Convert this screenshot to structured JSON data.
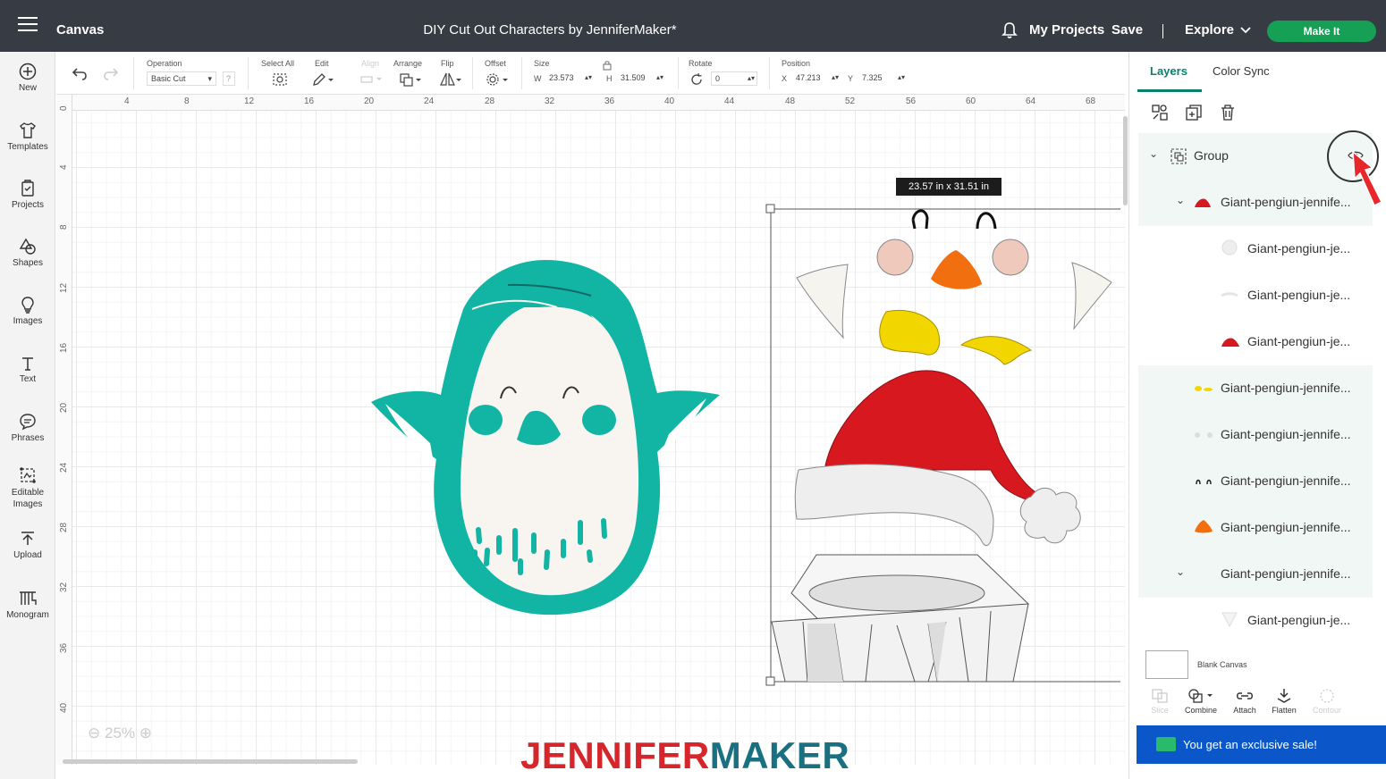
{
  "header": {
    "canvas_label": "Canvas",
    "doc_title": "DIY Cut Out Characters by JenniferMaker*",
    "my_projects": "My Projects",
    "save": "Save",
    "divider": "|",
    "explore": "Explore",
    "make_it": "Make It"
  },
  "leftnav": [
    {
      "label": "New",
      "icon": "plus-circle-icon"
    },
    {
      "label": "Templates",
      "icon": "shirt-icon"
    },
    {
      "label": "Projects",
      "icon": "projects-icon"
    },
    {
      "label": "Shapes",
      "icon": "shapes-icon"
    },
    {
      "label": "Images",
      "icon": "lightbulb-icon"
    },
    {
      "label": "Text",
      "icon": "text-icon"
    },
    {
      "label": "Phrases",
      "icon": "speech-bubble-icon"
    },
    {
      "label": "Editable Images",
      "icon": "editable-images-icon"
    },
    {
      "label": "Upload",
      "icon": "upload-icon"
    },
    {
      "label": "Monogram",
      "icon": "monogram-icon"
    }
  ],
  "toolbar": {
    "operation_label": "Operation",
    "operation_value": "Basic Cut",
    "help": "?",
    "select_all_label": "Select All",
    "edit_label": "Edit",
    "align_label": "Align",
    "arrange_label": "Arrange",
    "flip_label": "Flip",
    "offset_label": "Offset",
    "size_label": "Size",
    "w_label": "W",
    "w_value": "23.573",
    "h_label": "H",
    "h_value": "31.509",
    "rotate_label": "Rotate",
    "rotate_value": "0",
    "position_label": "Position",
    "x_label": "X",
    "x_value": "47.213",
    "y_label": "Y",
    "y_value": "7.325"
  },
  "ruler": {
    "top": [
      "4",
      "8",
      "12",
      "16",
      "20",
      "24",
      "28",
      "32",
      "36",
      "40",
      "44",
      "48",
      "52",
      "56",
      "60",
      "64",
      "68"
    ],
    "left": [
      "0",
      "4",
      "8",
      "12",
      "16",
      "20",
      "24",
      "28",
      "32",
      "36",
      "40"
    ]
  },
  "size_tooltip": "23.57  in x 31.51  in",
  "zoom": "25%",
  "panel": {
    "tab_layers": "Layers",
    "tab_color_sync": "Color Sync",
    "group_label": "Group",
    "layers": [
      {
        "name": "Giant-pengiun-jennife...",
        "color": "#d7191f",
        "indent": 1,
        "expanded": true
      },
      {
        "name": "Giant-pengiun-je...",
        "color": "#eeeeee",
        "indent": 2
      },
      {
        "name": "Giant-pengiun-je...",
        "color": "#f4f4f4",
        "indent": 2
      },
      {
        "name": "Giant-pengiun-je...",
        "color": "#d7191f",
        "indent": 2
      },
      {
        "name": "Giant-pengiun-jennife...",
        "color": "#f2d600",
        "indent": 1
      },
      {
        "name": "Giant-pengiun-jennife...",
        "color": "#dddddd",
        "indent": 1
      },
      {
        "name": "Giant-pengiun-jennife...",
        "color": "#222222",
        "indent": 1
      },
      {
        "name": "Giant-pengiun-jennife...",
        "color": "#f26f10",
        "indent": 1
      },
      {
        "name": "Giant-pengiun-jennife...",
        "color": "#ffffff",
        "indent": 1,
        "expanded": true
      },
      {
        "name": "Giant-pengiun-je...",
        "color": "#eeeeee",
        "indent": 2
      }
    ],
    "blank_canvas": "Blank Canvas",
    "bottom_tools": [
      {
        "label": "Slice",
        "enabled": false
      },
      {
        "label": "Combine",
        "enabled": true
      },
      {
        "label": "Attach",
        "enabled": true
      },
      {
        "label": "Flatten",
        "enabled": true
      },
      {
        "label": "Contour",
        "enabled": false
      }
    ],
    "promo": "You get an exclusive sale!"
  },
  "watermark": {
    "part1": "JENNIFER",
    "part2": "MAKER"
  },
  "colors": {
    "topbar": "#373b43",
    "make_it": "#15a055",
    "penguin_teal": "#12b5a4",
    "hat_red": "#d7191f",
    "beak_orange": "#f26f10",
    "feet_yellow": "#f2d600",
    "cheek_pink": "#f0c9bd",
    "promo_blue": "#0b57c9"
  }
}
